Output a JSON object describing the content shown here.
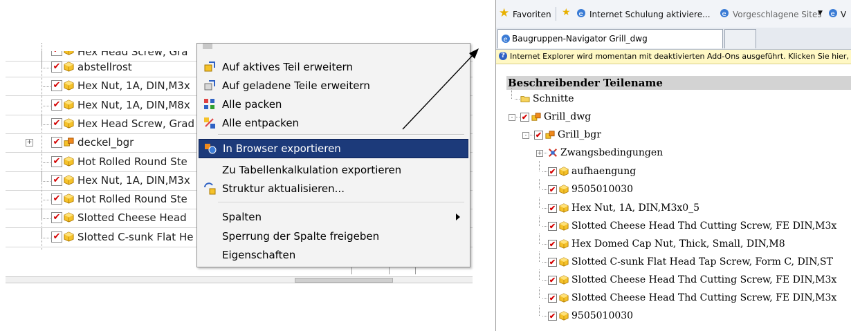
{
  "left_tree": {
    "rows": [
      {
        "label": "Hex Head Screw, Gra",
        "checked": true,
        "icon": "part-icon"
      },
      {
        "label": "abstellrost",
        "checked": true,
        "icon": "part-icon"
      },
      {
        "label": "Hex Nut, 1A, DIN,M3x",
        "checked": true,
        "icon": "part-icon"
      },
      {
        "label": "Hex Nut, 1A, DIN,M8x",
        "checked": true,
        "icon": "part-icon"
      },
      {
        "label": "Hex Head Screw, Grad",
        "checked": true,
        "icon": "part-icon"
      },
      {
        "label": "deckel_bgr",
        "checked": true,
        "icon": "assembly-icon",
        "expander": "+"
      },
      {
        "label": "Hot Rolled Round Ste",
        "checked": true,
        "icon": "part-icon"
      },
      {
        "label": "Hex Nut, 1A, DIN,M3x",
        "checked": true,
        "icon": "part-icon"
      },
      {
        "label": "Hot Rolled Round Ste",
        "checked": true,
        "icon": "part-icon"
      },
      {
        "label": "Slotted Cheese Head",
        "checked": true,
        "icon": "part-icon"
      },
      {
        "label": "Slotted C-sunk Flat He",
        "checked": true,
        "icon": "part-icon"
      }
    ]
  },
  "context_menu": {
    "items": [
      {
        "label": "Auf aktives Teil erweitern",
        "icon": "expand-active-part-icon"
      },
      {
        "label": "Auf geladene Teile erweitern",
        "icon": "expand-loaded-parts-icon"
      },
      {
        "label": "Alle packen",
        "icon": "pack-all-icon"
      },
      {
        "label": "Alle entpacken",
        "icon": "unpack-all-icon"
      },
      {
        "label": "In Browser exportieren",
        "icon": "export-browser-icon",
        "active": true
      },
      {
        "label": "Zu Tabellenkalkulation exportieren",
        "icon": ""
      },
      {
        "label": "Struktur aktualisieren...",
        "icon": "update-structure-icon"
      },
      {
        "label": "Spalten",
        "icon": "",
        "submenu": true
      },
      {
        "label": "Sperrung der Spalte freigeben",
        "icon": ""
      },
      {
        "label": "Eigenschaften",
        "icon": ""
      }
    ]
  },
  "browser": {
    "favorites_label": "Favoriten",
    "fav_link_1": "Internet Schulung aktiviere...",
    "fav_link_2": "Vorgeschlagene Sites",
    "fav_link_3": "V",
    "tab_title": "Baugruppen-Navigator Grill_dwg",
    "infobar_text": "Internet Explorer wird momentan mit deaktivierten Add-Ons ausgeführt. Klicken Sie hier, u",
    "column_header": "Beschreibender Teilename",
    "tree": [
      {
        "label": "Schnitte",
        "level": 0,
        "icon": "folder-icon",
        "checked": null,
        "expander": ""
      },
      {
        "label": "Grill_dwg",
        "level": 0,
        "icon": "assembly-icon",
        "checked": true,
        "expander": "-"
      },
      {
        "label": "Grill_bgr",
        "level": 1,
        "icon": "assembly-icon",
        "checked": true,
        "expander": "-"
      },
      {
        "label": "Zwangsbedingungen",
        "level": 2,
        "icon": "constraints-icon",
        "checked": null,
        "expander": "+"
      },
      {
        "label": "aufhaengung",
        "level": 2,
        "icon": "part-icon",
        "checked": true,
        "expander": ""
      },
      {
        "label": "9505010030",
        "level": 2,
        "icon": "part-icon",
        "checked": true,
        "expander": ""
      },
      {
        "label": "Hex Nut, 1A, DIN,M3x0_5",
        "level": 2,
        "icon": "part-icon",
        "checked": true,
        "expander": ""
      },
      {
        "label": "Slotted Cheese Head Thd Cutting Screw, FE DIN,M3x",
        "level": 2,
        "icon": "part-icon",
        "checked": true,
        "expander": ""
      },
      {
        "label": "Hex Domed Cap Nut, Thick, Small, DIN,M8",
        "level": 2,
        "icon": "part-icon",
        "checked": true,
        "expander": ""
      },
      {
        "label": "Slotted C-sunk Flat Head Tap Screw, Form C, DIN,ST",
        "level": 2,
        "icon": "part-icon",
        "checked": true,
        "expander": ""
      },
      {
        "label": "Slotted Cheese Head Thd Cutting Screw, FE DIN,M3x",
        "level": 2,
        "icon": "part-icon",
        "checked": true,
        "expander": ""
      },
      {
        "label": "Slotted Cheese Head Thd Cutting Screw, FE DIN,M3x",
        "level": 2,
        "icon": "part-icon",
        "checked": true,
        "expander": ""
      },
      {
        "label": "9505010030",
        "level": 2,
        "icon": "part-icon",
        "checked": true,
        "expander": ""
      }
    ]
  },
  "colors": {
    "menu_highlight": "#1c3a7a",
    "check_red": "#d40000",
    "part_yellow": "#f5c22a",
    "infobar_bg": "#fff8c4"
  }
}
